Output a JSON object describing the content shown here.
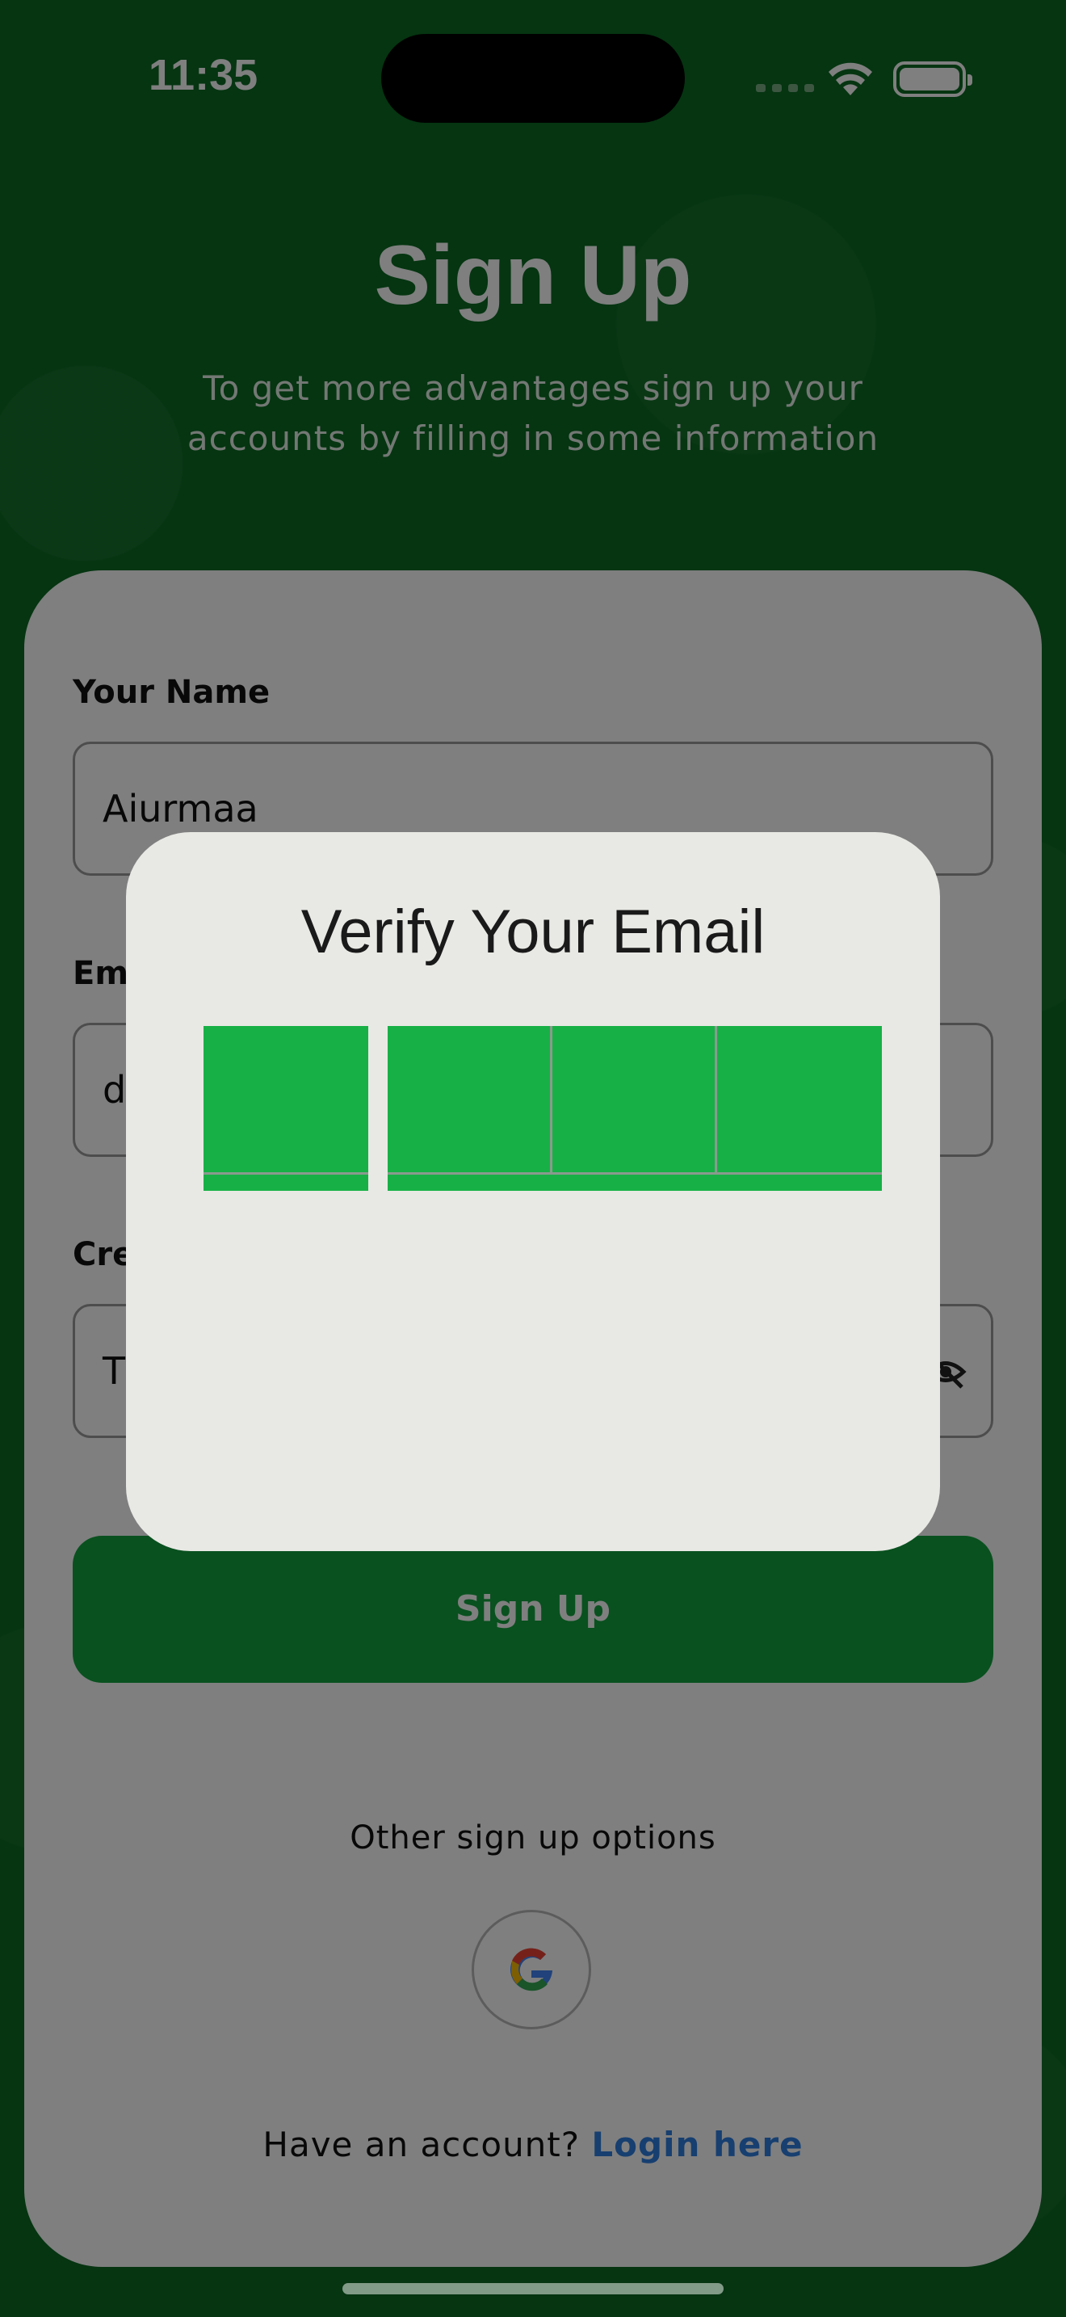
{
  "status_bar": {
    "time": "11:35"
  },
  "header": {
    "title": "Sign Up",
    "subtitle": "To get more advantages sign up your accounts by filling in some information"
  },
  "form": {
    "name_label": "Your Name",
    "name_value": "Aiurmaa",
    "email_label": "Em",
    "email_value": "d",
    "password_label": "Cre",
    "password_value": "T",
    "submit_label": "Sign Up"
  },
  "other_options": {
    "label": "Other sign up options",
    "google_icon": "google-icon"
  },
  "footer": {
    "prompt": "Have an account? ",
    "login_label": "Login here"
  },
  "dialog": {
    "title": "Verify Your Email",
    "otp_values": [
      "",
      "",
      "",
      ""
    ]
  },
  "colors": {
    "background": "#0a6a22",
    "card": "#ffffff",
    "primary_button": "#12a33f",
    "otp_fill": "#17b046",
    "dialog_bg": "#e8e9e4",
    "link": "#2f7fe0",
    "overlay": "rgba(0,0,0,0.5)"
  }
}
